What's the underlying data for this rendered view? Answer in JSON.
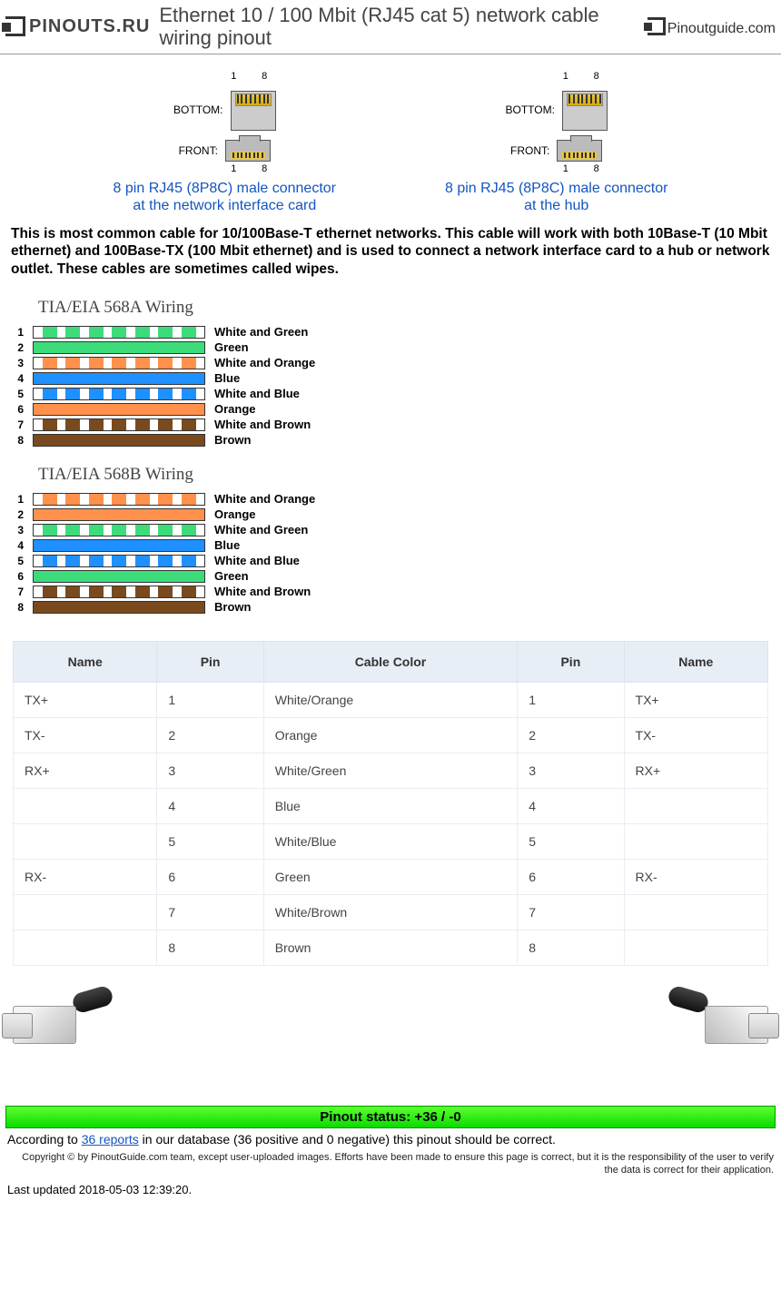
{
  "header": {
    "logo_left": "PINOUTS.RU",
    "title": "Ethernet 10 / 100 Mbit (RJ45 cat 5) network cable wiring pinout",
    "logo_right_main": "Pinout",
    "logo_right_sub": "guide",
    "logo_right_tld": ".com"
  },
  "connectors": {
    "bottom_label": "BOTTOM:",
    "front_label": "FRONT:",
    "pin1": "1",
    "pin8": "8",
    "left_link_l1": "8 pin RJ45 (8P8C) male connector",
    "left_link_l2": "at the network interface card",
    "right_link_l1": "8 pin RJ45 (8P8C) male connector",
    "right_link_l2": "at the hub"
  },
  "intro": "This is most common cable for 10/100Base-T ethernet networks. This cable will work with both 10Base-T (10 Mbit ethernet) and 100Base-TX (100 Mbit ethernet) and is used to connect a network interface card to a hub or network outlet. These cables are sometimes called wipes.",
  "wiring568a_title": "TIA/EIA 568A Wiring",
  "wiring568a": [
    {
      "n": "1",
      "label": "White and Green",
      "type": "striped",
      "color": "#3cdc7a"
    },
    {
      "n": "2",
      "label": "Green",
      "type": "solid",
      "color": "#3cdc7a"
    },
    {
      "n": "3",
      "label": "White and Orange",
      "type": "striped",
      "color": "#ff914d"
    },
    {
      "n": "4",
      "label": "Blue",
      "type": "solid",
      "color": "#1e90ff"
    },
    {
      "n": "5",
      "label": "White and Blue",
      "type": "striped",
      "color": "#1e90ff"
    },
    {
      "n": "6",
      "label": "Orange",
      "type": "solid",
      "color": "#ff914d"
    },
    {
      "n": "7",
      "label": "White and Brown",
      "type": "striped",
      "color": "#7a4a1f"
    },
    {
      "n": "8",
      "label": "Brown",
      "type": "solid",
      "color": "#7a4a1f"
    }
  ],
  "wiring568b_title": "TIA/EIA 568B Wiring",
  "wiring568b": [
    {
      "n": "1",
      "label": "White and Orange",
      "type": "striped",
      "color": "#ff914d"
    },
    {
      "n": "2",
      "label": "Orange",
      "type": "solid",
      "color": "#ff914d"
    },
    {
      "n": "3",
      "label": "White and Green",
      "type": "striped",
      "color": "#3cdc7a"
    },
    {
      "n": "4",
      "label": "Blue",
      "type": "solid",
      "color": "#1e90ff"
    },
    {
      "n": "5",
      "label": "White and Blue",
      "type": "striped",
      "color": "#1e90ff"
    },
    {
      "n": "6",
      "label": "Green",
      "type": "solid",
      "color": "#3cdc7a"
    },
    {
      "n": "7",
      "label": "White and Brown",
      "type": "striped",
      "color": "#7a4a1f"
    },
    {
      "n": "8",
      "label": "Brown",
      "type": "solid",
      "color": "#7a4a1f"
    }
  ],
  "table": {
    "headers": [
      "Name",
      "Pin",
      "Cable Color",
      "Pin",
      "Name"
    ],
    "rows": [
      [
        "TX+",
        "1",
        "White/Orange",
        "1",
        "TX+"
      ],
      [
        "TX-",
        "2",
        "Orange",
        "2",
        "TX-"
      ],
      [
        "RX+",
        "3",
        "White/Green",
        "3",
        "RX+"
      ],
      [
        "",
        "4",
        "Blue",
        "4",
        ""
      ],
      [
        "",
        "5",
        "White/Blue",
        "5",
        ""
      ],
      [
        "RX-",
        "6",
        "Green",
        "6",
        "RX-"
      ],
      [
        "",
        "7",
        "White/Brown",
        "7",
        ""
      ],
      [
        "",
        "8",
        "Brown",
        "8",
        ""
      ]
    ]
  },
  "status": "Pinout status: +36 / -0",
  "status_text_pre": "According to ",
  "status_link": "36 reports",
  "status_text_post": " in our database (36 positive and 0 negative) this pinout should be correct.",
  "copyright": "Copyright © by PinoutGuide.com team, except user-uploaded images. Efforts have been made to ensure this page is correct, but it is the responsibility of the user to verify the data is correct for their application.",
  "updated": "Last updated 2018-05-03 12:39:20."
}
